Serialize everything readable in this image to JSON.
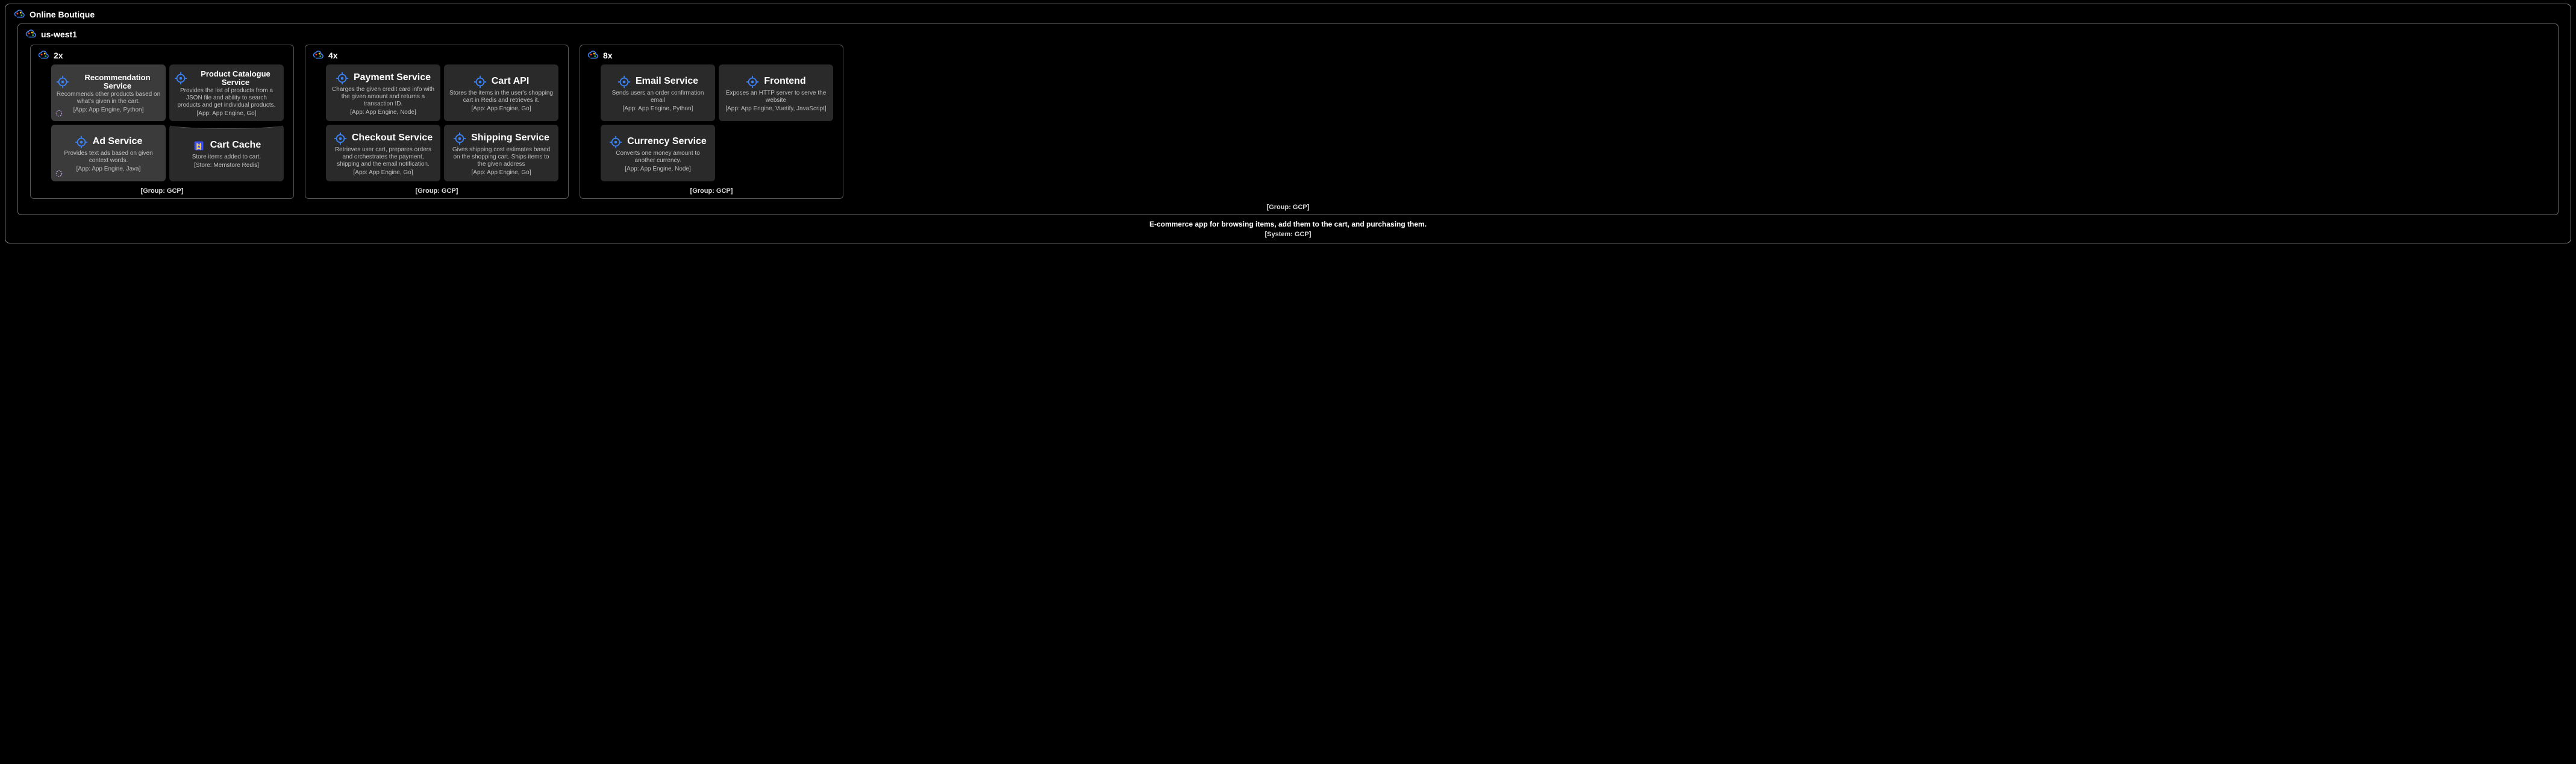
{
  "system": {
    "title": "Online Boutique",
    "description": "E-commerce app for browsing items, add them to the cart, and purchasing them.",
    "footer": "[System: GCP]"
  },
  "region": {
    "title": "us-west1",
    "footer": "[Group: GCP]"
  },
  "groups": [
    {
      "title": "2x",
      "footer": "[Group: GCP]",
      "cards": [
        {
          "id": "recommendation-service",
          "title": "Recommendation Service",
          "desc": "Recommends other products based on what's given in the cart.",
          "meta": "[App: App Engine, Python]",
          "selected": true,
          "hasSwirl": true,
          "titleSize": "small",
          "iconType": "target"
        },
        {
          "id": "product-catalogue-service",
          "title": "Product Catalogue Service",
          "desc": "Provides the list of products from a JSON file and ability to search products and get individual products.",
          "meta": "[App: App Engine, Go]",
          "titleSize": "small",
          "iconType": "target"
        },
        {
          "id": "ad-service",
          "title": "Ad Service",
          "desc": "Provides text ads based on given context words.",
          "meta": "[App: App Engine, Java]",
          "selected": true,
          "hasSwirl": true,
          "iconType": "target"
        },
        {
          "id": "cart-cache",
          "title": "Cart Cache",
          "desc": "Store items added to cart.",
          "meta": "[Store: Memstore Redis]",
          "cylinder": true,
          "iconType": "redis"
        }
      ]
    },
    {
      "title": "4x",
      "footer": "[Group: GCP]",
      "cards": [
        {
          "id": "payment-service",
          "title": "Payment Service",
          "desc": "Charges the given credit card info with the given amount and returns a transaction ID.",
          "meta": "[App: App Engine, Node]",
          "iconType": "target"
        },
        {
          "id": "cart-api",
          "title": "Cart API",
          "desc": "Stores the items in the user's shopping cart in Redis and retrieves it.",
          "meta": "[App: App Engine, Go]",
          "iconType": "target"
        },
        {
          "id": "checkout-service",
          "title": "Checkout Service",
          "desc": "Retrieves user cart, prepares orders and orchestrates the payment, shipping and the email notification.",
          "meta": "[App: App Engine, Go]",
          "iconType": "target"
        },
        {
          "id": "shipping-service",
          "title": "Shipping Service",
          "desc": "Gives shipping cost estimates based on the shopping cart. Ships items to the given address",
          "meta": "[App: App Engine, Go]",
          "iconType": "target"
        }
      ]
    },
    {
      "title": "8x",
      "footer": "[Group: GCP]",
      "cards": [
        {
          "id": "email-service",
          "title": "Email Service",
          "desc": "Sends users an order confirmation email",
          "meta": "[App: App Engine, Python]",
          "iconType": "target"
        },
        {
          "id": "frontend",
          "title": "Frontend",
          "desc": "Exposes an HTTP server to serve the website",
          "meta": "[App: App Engine, Vuetify, JavaScript]",
          "iconType": "target"
        },
        {
          "id": "currency-service",
          "title": "Currency Service",
          "desc": "Converts one money amount to another currency.",
          "meta": "[App: App Engine, Node]",
          "iconType": "target"
        }
      ]
    }
  ]
}
